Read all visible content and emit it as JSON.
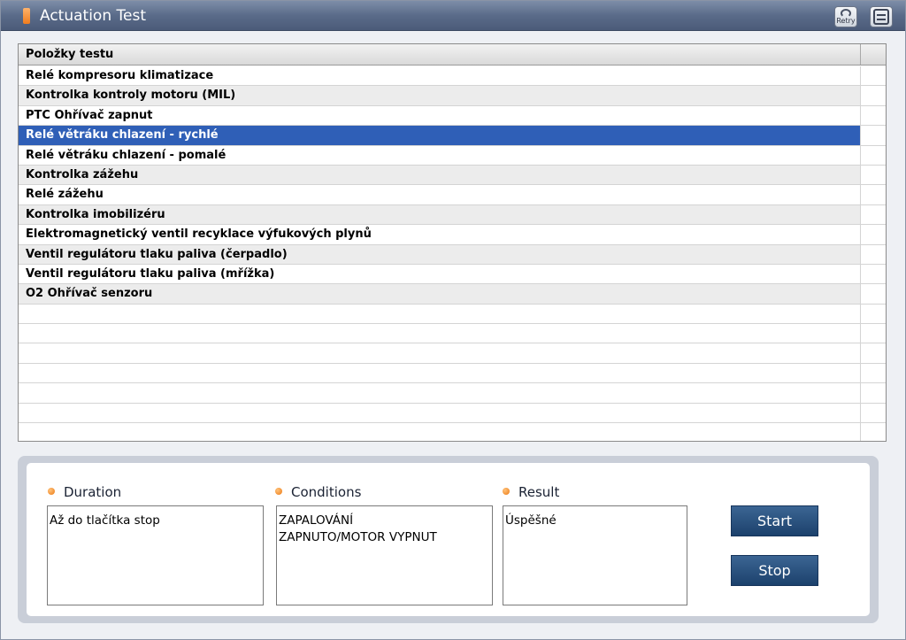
{
  "window": {
    "title": "Actuation Test"
  },
  "toolbar": {
    "retry_label": "Retry"
  },
  "colors": {
    "titlebar": "#5a6b89",
    "selection": "#2f5fb7",
    "accent_dot": "#ec7a14",
    "button": "#2a527f"
  },
  "table": {
    "header": "Položky testu",
    "rows": [
      "Relé kompresoru klimatizace",
      "Kontrolka kontroly motoru (MIL)",
      "PTC Ohřívač zapnut",
      "Relé větráku chlazení - rychlé",
      "Relé větráku chlazení - pomalé",
      "Kontrolka zážehu",
      "Relé zážehu",
      "Kontrolka imobilizéru",
      "Elektromagnetický ventil recyklace výfukových plynů",
      "Ventil regulátoru tlaku paliva (čerpadlo)",
      "Ventil regulátoru tlaku paliva (mřížka)",
      "O2 Ohřívač senzoru",
      "",
      "",
      "",
      "",
      "",
      "",
      ""
    ],
    "selected_index": 3
  },
  "details": {
    "duration": {
      "label": "Duration",
      "value": "Až do tlačítka stop"
    },
    "conditions": {
      "label": "Conditions",
      "value": "ZAPALOVÁNÍ\nZAPNUTO/MOTOR VYPNUT"
    },
    "result": {
      "label": "Result",
      "value": "Úspěšné"
    }
  },
  "buttons": {
    "start_label": "Start",
    "stop_label": "Stop"
  }
}
